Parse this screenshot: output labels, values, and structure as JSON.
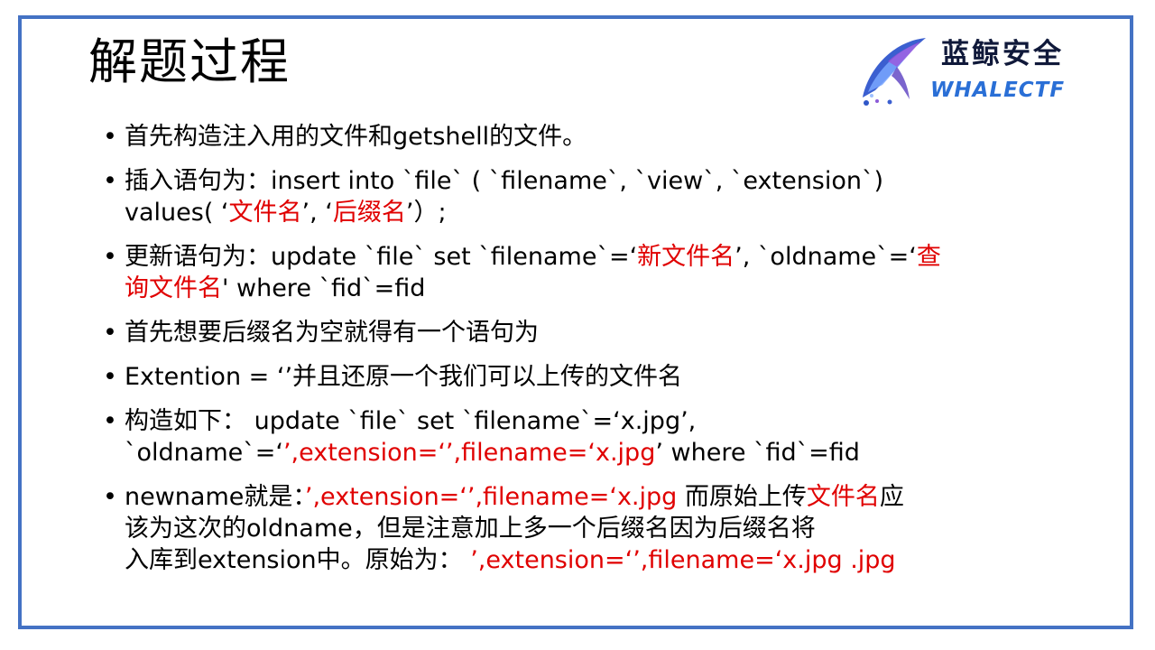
{
  "slide": {
    "title": "解题过程",
    "logo": {
      "name_cn": "蓝鲸安全",
      "name_en": "WHALECTF"
    },
    "bullets": [
      {
        "segments": [
          "首先构造注入用的文件和getshell的文件。"
        ]
      },
      {
        "line1": [
          "插入语句为：insert into `file` ( `filename`, `view`, `extension`)"
        ],
        "line2": [
          "values( ‘",
          "文件名",
          "’, ‘",
          "后缀名",
          "’）;"
        ]
      },
      {
        "line1": [
          "更新语句为：update `file` set `filename`=‘",
          "新文件名",
          "’, `oldname`=‘",
          "查"
        ],
        "line2": [
          "询文件名",
          "' where `fid`=fid"
        ]
      },
      {
        "segments": [
          "首先想要后缀名为空就得有一个语句为"
        ]
      },
      {
        "segments": [
          "Extention = ‘’并且还原一个我们可以上传的文件名"
        ]
      },
      {
        "line1": [
          "构造如下： update `file` set `filename`=‘x.jpg’,"
        ],
        "line2": [
          "`oldname`=‘",
          "’,extension=‘’,filename=‘x.jpg",
          "’ where `fid`=fid"
        ]
      },
      {
        "line1": [
          "newname就是：",
          "’,extension=‘’,filename=‘x.jpg",
          " 而原始上传",
          "文件名",
          "应"
        ],
        "line2": [
          "该为这次的oldname，但是注意加上多一个后缀名因为后缀名将"
        ],
        "line3": [
          "入库到extension中。原始为： ",
          "’,extension=‘’,filename=‘x.jpg .jpg"
        ]
      }
    ]
  }
}
